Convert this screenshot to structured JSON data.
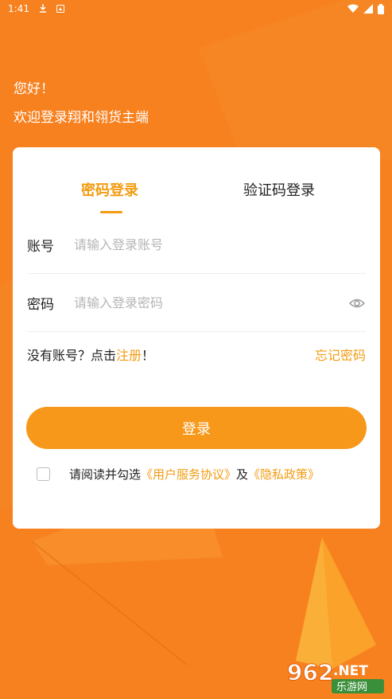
{
  "status_bar": {
    "time": "1:41",
    "icons": [
      "download-icon",
      "notification-icon",
      "wifi-icon",
      "signal-icon",
      "battery-icon"
    ]
  },
  "greeting": {
    "hello": "您好！",
    "welcome": "欢迎登录翔和翎货主端"
  },
  "tabs": {
    "password_login": "密码登录",
    "code_login": "验证码登录",
    "active": "password_login"
  },
  "account_field": {
    "label": "账号",
    "placeholder": "请输入登录账号",
    "value": ""
  },
  "password_field": {
    "label": "密码",
    "placeholder": "请输入登录密码",
    "value": "",
    "toggle_icon": "eye-icon"
  },
  "register": {
    "prefix": "没有账号？点击",
    "link": "注册",
    "suffix": "！",
    "forgot": "忘记密码"
  },
  "login_button": {
    "label": "登录"
  },
  "agreement": {
    "checked": false,
    "prefix": "请阅读并勾选",
    "user_agreement": "《用户服务协议》",
    "connector": "及",
    "privacy_policy": "《隐私政策》"
  },
  "watermark": {
    "number": "962",
    "suffix": ".NET",
    "subtitle": "乐游网"
  },
  "colors": {
    "background": "#f7811f",
    "accent": "#f39c12",
    "button": "#f7981a"
  }
}
